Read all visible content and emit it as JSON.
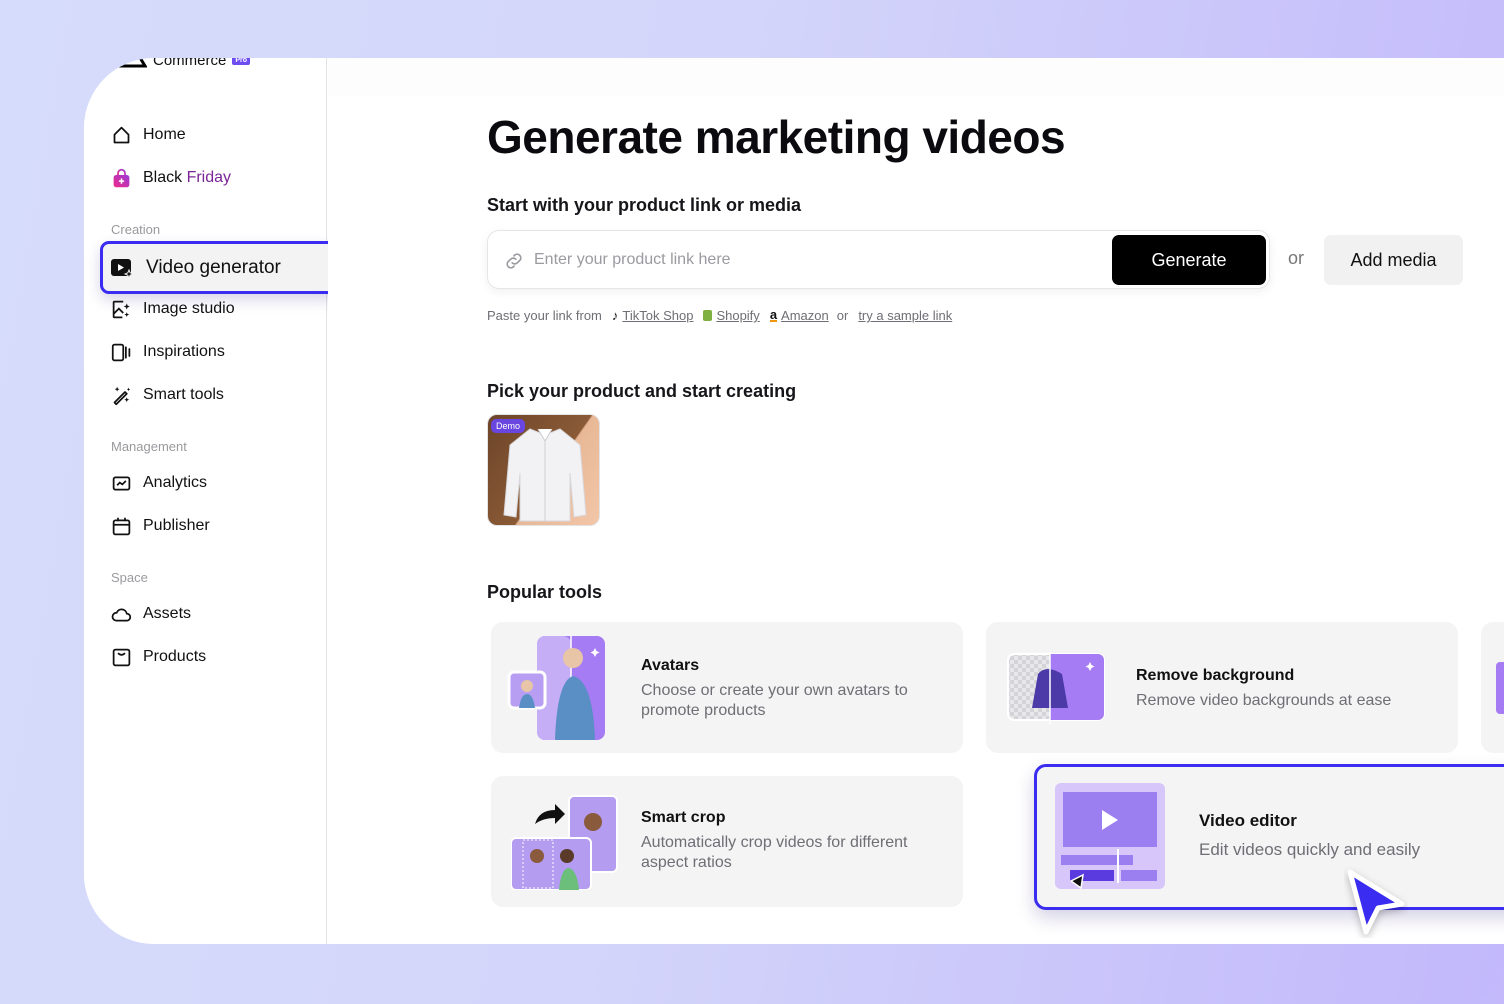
{
  "brand": {
    "name": "Commerce",
    "badge": "Pro"
  },
  "sidebar": {
    "items_top": [
      {
        "label": "Home",
        "icon": "home-icon"
      },
      {
        "label_a": "Black",
        "label_b": "Friday",
        "icon": "shopping-bag-icon"
      }
    ],
    "sections": [
      {
        "title": "Creation",
        "items": [
          {
            "label": "Video generator",
            "icon": "video-sparkle-icon",
            "active": true
          },
          {
            "label": "Image studio",
            "icon": "image-sparkle-icon"
          },
          {
            "label": "Inspirations",
            "icon": "inspirations-icon"
          },
          {
            "label": "Smart tools",
            "icon": "magic-wand-icon"
          }
        ]
      },
      {
        "title": "Management",
        "items": [
          {
            "label": "Analytics",
            "icon": "analytics-icon"
          },
          {
            "label": "Publisher",
            "icon": "calendar-icon"
          }
        ]
      },
      {
        "title": "Space",
        "items": [
          {
            "label": "Assets",
            "icon": "cloud-icon"
          },
          {
            "label": "Products",
            "icon": "product-box-icon"
          }
        ]
      }
    ]
  },
  "main": {
    "title": "Generate marketing videos",
    "link_section": {
      "heading": "Start with your product link or media",
      "placeholder": "Enter your product link here",
      "value": "",
      "generate_label": "Generate",
      "or_label": "or",
      "add_media_label": "Add media",
      "paste_prefix": "Paste your link from",
      "sources": [
        {
          "label": "TikTok Shop",
          "icon": "tiktok-icon"
        },
        {
          "label": "Shopify",
          "icon": "shopify-icon"
        },
        {
          "label": "Amazon",
          "icon": "amazon-icon"
        }
      ],
      "or_text": "or",
      "sample_link": "try a sample link"
    },
    "product_section": {
      "heading": "Pick your product and start creating",
      "products": [
        {
          "badge": "Demo",
          "name": "White shirt"
        }
      ]
    },
    "tools_section": {
      "heading": "Popular tools",
      "tools": [
        {
          "title": "Avatars",
          "desc": "Choose or create your own avatars to promote products"
        },
        {
          "title": "Remove background",
          "desc": "Remove video backgrounds at ease"
        },
        {
          "title": "Smart crop",
          "desc": "Automatically crop videos for different aspect ratios"
        },
        {
          "title": "Video editor",
          "desc": "Edit videos quickly and easily",
          "highlighted": true
        }
      ]
    }
  },
  "colors": {
    "accent": "#3a2cf0",
    "purple": "#9b7ef0",
    "badge": "#6d4cf0"
  }
}
